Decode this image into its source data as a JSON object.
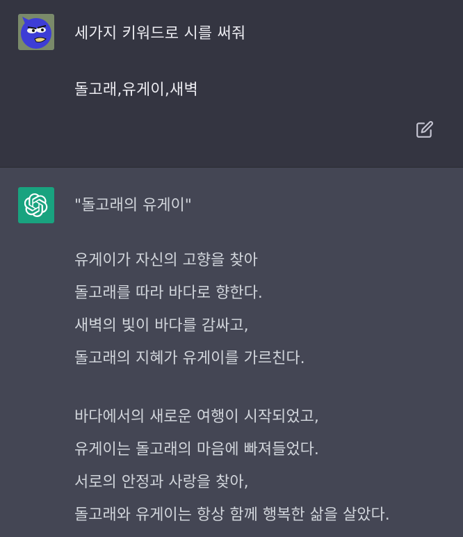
{
  "user_message": {
    "line1": "세가지 키워드로 시를 써줘",
    "line2": "돌고래,유게이,새벽"
  },
  "assistant_message": {
    "title": "\"돌고래의 유게이\"",
    "stanzas": [
      [
        "유게이가 자신의 고향을 찾아",
        "돌고래를 따라 바다로 향한다.",
        "새벽의 빛이 바다를 감싸고,",
        "돌고래의 지혜가 유게이를 가르친다."
      ],
      [
        "바다에서의 새로운 여행이 시작되었고,",
        "유게이는 돌고래의 마음에 빠져들었다.",
        "서로의 안정과 사랑을 찾아,",
        "돌고래와 유게이는 항상 함께 행복한 삶을 살았다."
      ]
    ]
  },
  "icons": {
    "edit": "edit-icon",
    "user_avatar": "user-avatar",
    "assistant_avatar": "openai-logo-icon"
  },
  "colors": {
    "user_bg": "#343541",
    "assistant_bg": "#444654",
    "assistant_avatar_bg": "#19a37f"
  }
}
